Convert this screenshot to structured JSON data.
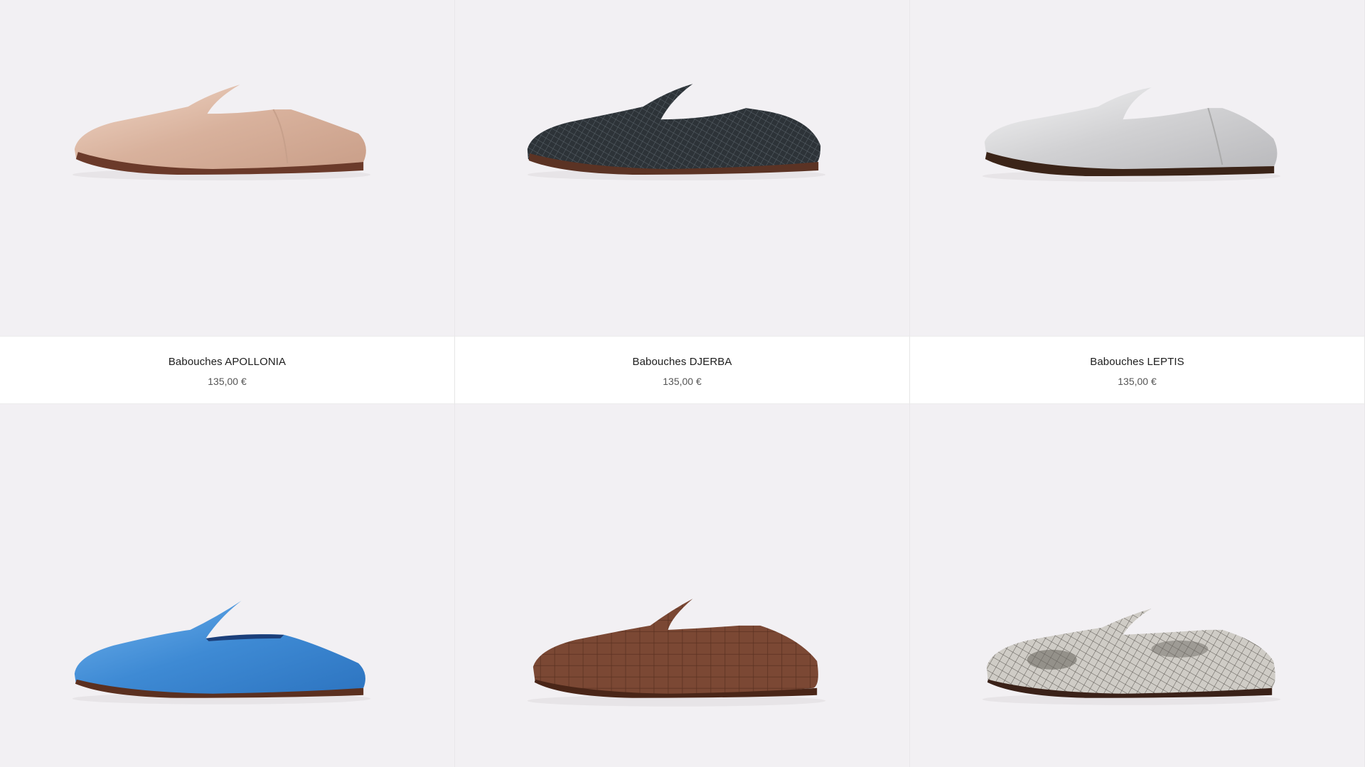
{
  "products": [
    {
      "name": "Babouches APOLLONIA",
      "price": "135,00 €",
      "image_icon": "rose-gold-metallic-babouche",
      "color": "#d9b7a3"
    },
    {
      "name": "Babouches DJERBA",
      "price": "135,00 €",
      "image_icon": "black-snakeskin-babouche",
      "color": "#2b3035"
    },
    {
      "name": "Babouches LEPTIS",
      "price": "135,00 €",
      "image_icon": "silver-metallic-babouche",
      "color": "#d4d4d6"
    },
    {
      "name": "",
      "price": "",
      "image_icon": "blue-metallic-babouche",
      "color": "#3f8fd6"
    },
    {
      "name": "",
      "price": "",
      "image_icon": "brown-croc-babouche",
      "color": "#7a4733"
    },
    {
      "name": "",
      "price": "",
      "image_icon": "python-print-babouche",
      "color": "#bdbab4"
    }
  ]
}
